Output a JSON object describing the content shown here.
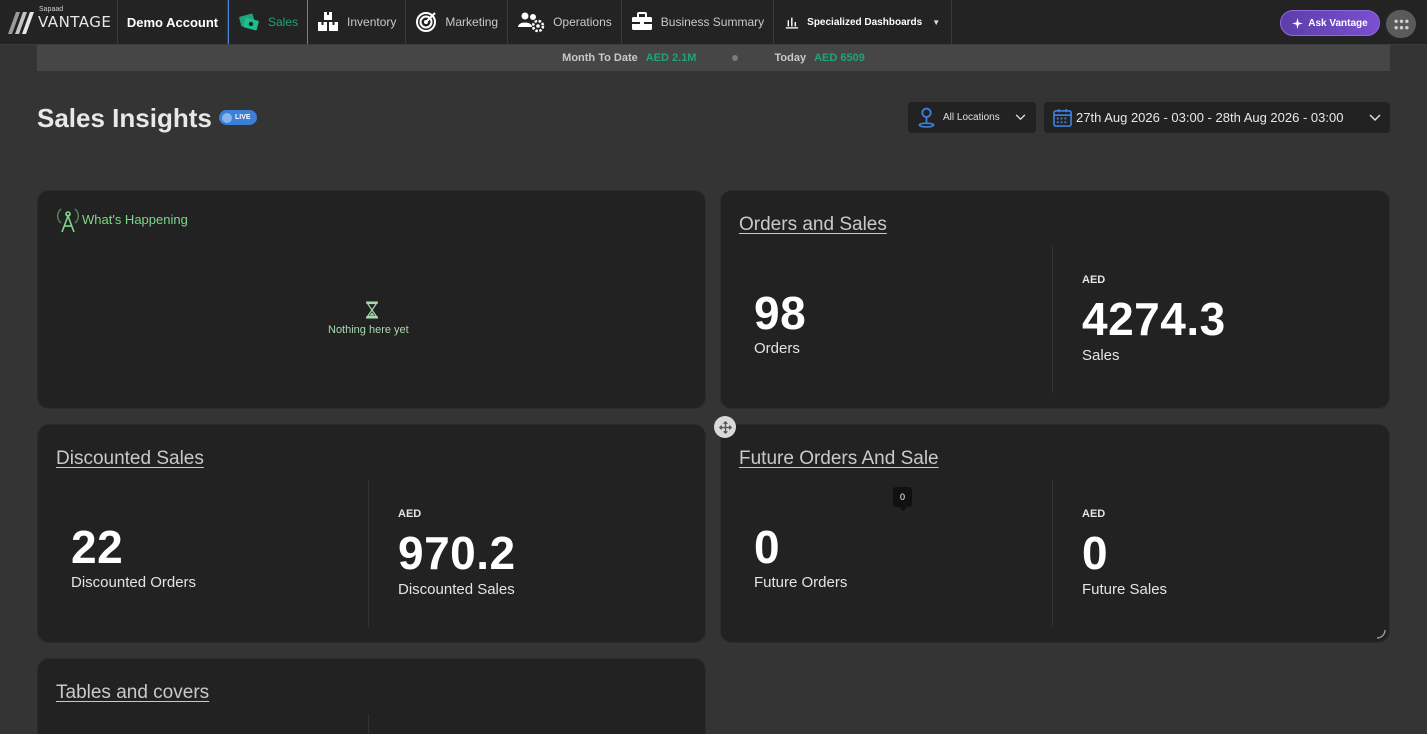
{
  "brand": {
    "small": "Sapaad",
    "name": "VANTAGE"
  },
  "account": "Demo Account",
  "nav": [
    {
      "label": "Sales",
      "icon": "sales-icon"
    },
    {
      "label": "Inventory",
      "icon": "inventory-icon"
    },
    {
      "label": "Marketing",
      "icon": "target-icon"
    },
    {
      "label": "Operations",
      "icon": "operations-icon"
    },
    {
      "label": "Business Summary",
      "icon": "briefcase-icon"
    },
    {
      "label": "Specialized Dashboards",
      "icon": "bar-chart-icon"
    }
  ],
  "ask_button": "Ask Vantage",
  "ticker": {
    "mtd_label": "Month To Date",
    "mtd_value": "AED 2.1M",
    "today_label": "Today",
    "today_value": "AED 6509"
  },
  "header": {
    "title": "Sales Insights",
    "live": "LIVE",
    "location": "All Locations",
    "date_range": "27th Aug 2026 - 03:00 - 28th Aug 2026 - 03:00"
  },
  "happening": {
    "title": "What's Happening",
    "empty": "Nothing here yet"
  },
  "orders_sales": {
    "title": "Orders and Sales",
    "orders_value": "98",
    "orders_label": "Orders",
    "currency": "AED",
    "sales_value": "4274.3",
    "sales_label": "Sales"
  },
  "discounted": {
    "title": "Discounted Sales",
    "orders_value": "22",
    "orders_label": "Discounted Orders",
    "currency": "AED",
    "sales_value": "970.2",
    "sales_label": "Discounted Sales"
  },
  "future": {
    "title": "Future Orders And Sale",
    "tooltip": "0",
    "orders_value": "0",
    "orders_label": "Future Orders",
    "currency": "AED",
    "sales_value": "0",
    "sales_label": "Future Sales"
  },
  "tables": {
    "title": "Tables and covers"
  },
  "colors": {
    "accent_green": "#1fa37a",
    "live_blue": "#3b7fd8",
    "ask_purple": "#6a47c0"
  }
}
